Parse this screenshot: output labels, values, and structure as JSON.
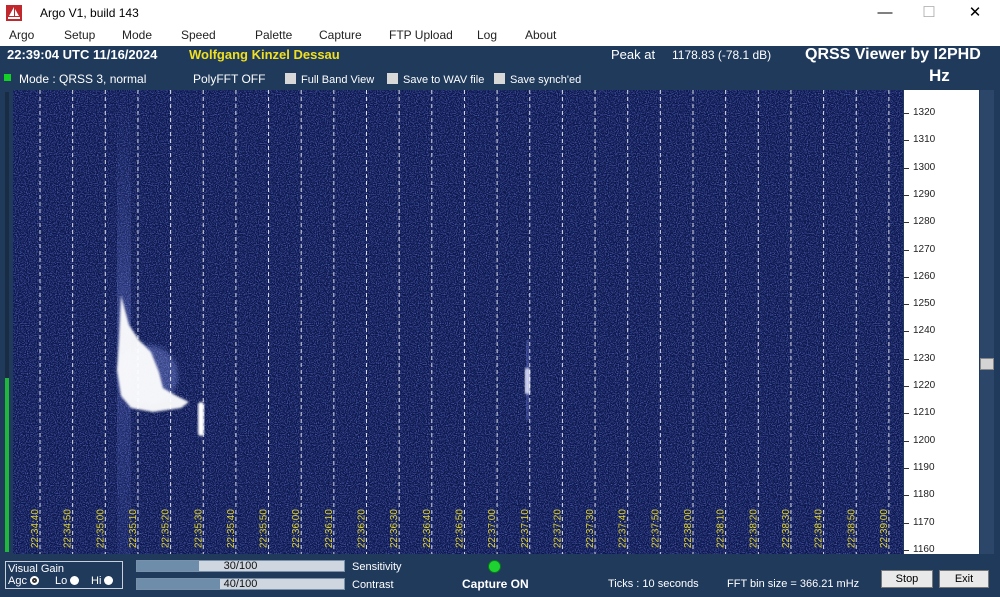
{
  "window": {
    "title": "Argo V1, build 143",
    "minimize": "—",
    "maximize": "☐",
    "close": "✕"
  },
  "menu": [
    "Argo",
    "Setup",
    "Mode",
    "Speed",
    "Palette",
    "Capture",
    "FTP Upload",
    "Log",
    "About"
  ],
  "header": {
    "datetime": "22:39:04 UTC  11/16/2024",
    "station": "Wolfgang Kinzel Dessau",
    "peak_label": "Peak at",
    "peak_value": "1178.83 (-78.1 dB)",
    "app_name": "QRSS Viewer by I2PHD",
    "unit": "Hz"
  },
  "options": {
    "mode": "Mode : QRSS 3, normal",
    "polyfft": "PolyFFT OFF",
    "full_band": "Full Band View",
    "save_wav": "Save to WAV file",
    "save_synch": "Save synch'ed"
  },
  "freq_scale": [
    "1320",
    "1310",
    "1300",
    "1290",
    "1280",
    "1270",
    "1260",
    "1250",
    "1240",
    "1230",
    "1220",
    "1210",
    "1200",
    "1190",
    "1180",
    "1170",
    "1160"
  ],
  "time_labels": [
    "22:34:40",
    "22:34:50",
    "22:35:00",
    "22:35:10",
    "22:35:20",
    "22:35:30",
    "22:35:40",
    "22:35:50",
    "22:36:00",
    "22:36:10",
    "22:36:20",
    "22:36:30",
    "22:36:40",
    "22:36:50",
    "22:37:00",
    "22:37:10",
    "22:37:20",
    "22:37:30",
    "22:37:40",
    "22:37:50",
    "22:38:00",
    "22:38:10",
    "22:38:20",
    "22:38:30",
    "22:38:40",
    "22:38:50",
    "22:39:00"
  ],
  "footer": {
    "visual_gain": "Visual Gain",
    "agc": "Agc",
    "lo": "Lo",
    "hi": "Hi",
    "sensitivity_value": "30/100",
    "sensitivity_fraction": 0.3,
    "sensitivity_label": "Sensitivity",
    "contrast_value": "40/100",
    "contrast_fraction": 0.4,
    "contrast_label": "Contrast",
    "capture_status": "Capture ON",
    "ticks": "Ticks   : 10 seconds",
    "fft_bin": "FFT bin size = 366.21 mHz",
    "stop": "Stop",
    "exit": "Exit"
  },
  "colors": {
    "waterfall_bg": "#0b164a",
    "panel": "#203a5c",
    "station": "#f0e020",
    "time_label": "#e3d52a",
    "led": "#12d025"
  }
}
